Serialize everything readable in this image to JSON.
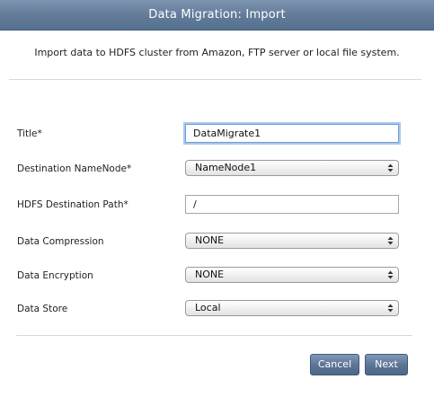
{
  "dialog": {
    "title": "Data Migration: Import",
    "description": "Import data to HDFS cluster from Amazon, FTP server or local file system."
  },
  "form": {
    "title": {
      "label": "Title*",
      "value": "DataMigrate1"
    },
    "destination_namenode": {
      "label": "Destination NameNode*",
      "value": "NameNode1"
    },
    "hdfs_destination_path": {
      "label": "HDFS Destination Path*",
      "value": "/"
    },
    "data_compression": {
      "label": "Data Compression",
      "value": "NONE"
    },
    "data_encryption": {
      "label": "Data Encryption",
      "value": "NONE"
    },
    "data_store": {
      "label": "Data Store",
      "value": "Local"
    }
  },
  "buttons": {
    "cancel": "Cancel",
    "next": "Next"
  },
  "colors": {
    "titlebar": "#617a98",
    "button": "#5d7698",
    "focus_ring": "#6d9fd6"
  },
  "icons": {
    "select_arrows": "up-down-chevron-icon"
  }
}
